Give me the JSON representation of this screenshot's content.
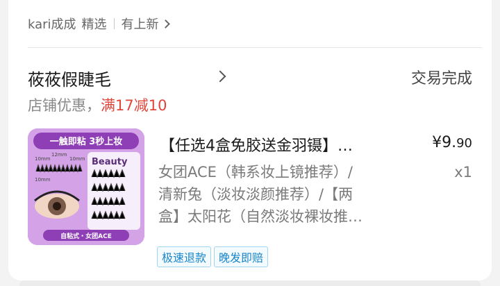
{
  "header": {
    "user": "kari成成",
    "tag": "精选",
    "link": "有上新"
  },
  "shop": {
    "name": "莜莜假睫毛",
    "status": "交易完成",
    "promo_prefix": "店铺优惠，",
    "promo_value": "满17减10"
  },
  "product": {
    "title": "【任选4盒免胶送金羽镊】…",
    "price_main": "¥9.",
    "price_cents": "90",
    "spec_lines": [
      "女团ACE（韩系妆上镜推荐）/",
      "清新兔（淡妆淡颜推荐）/【两",
      "盒】太阳花（自然淡妆裸妆推…"
    ],
    "quantity": "x1",
    "tags": [
      "极速退款",
      "晚发即赔"
    ]
  },
  "image": {
    "banner": "一触即粘 3秒上妆",
    "brand": "Beauty",
    "footer": "自粘式・女团ACE",
    "size_labels": [
      "10mm",
      "12mm",
      "10mm",
      "10mm"
    ]
  }
}
